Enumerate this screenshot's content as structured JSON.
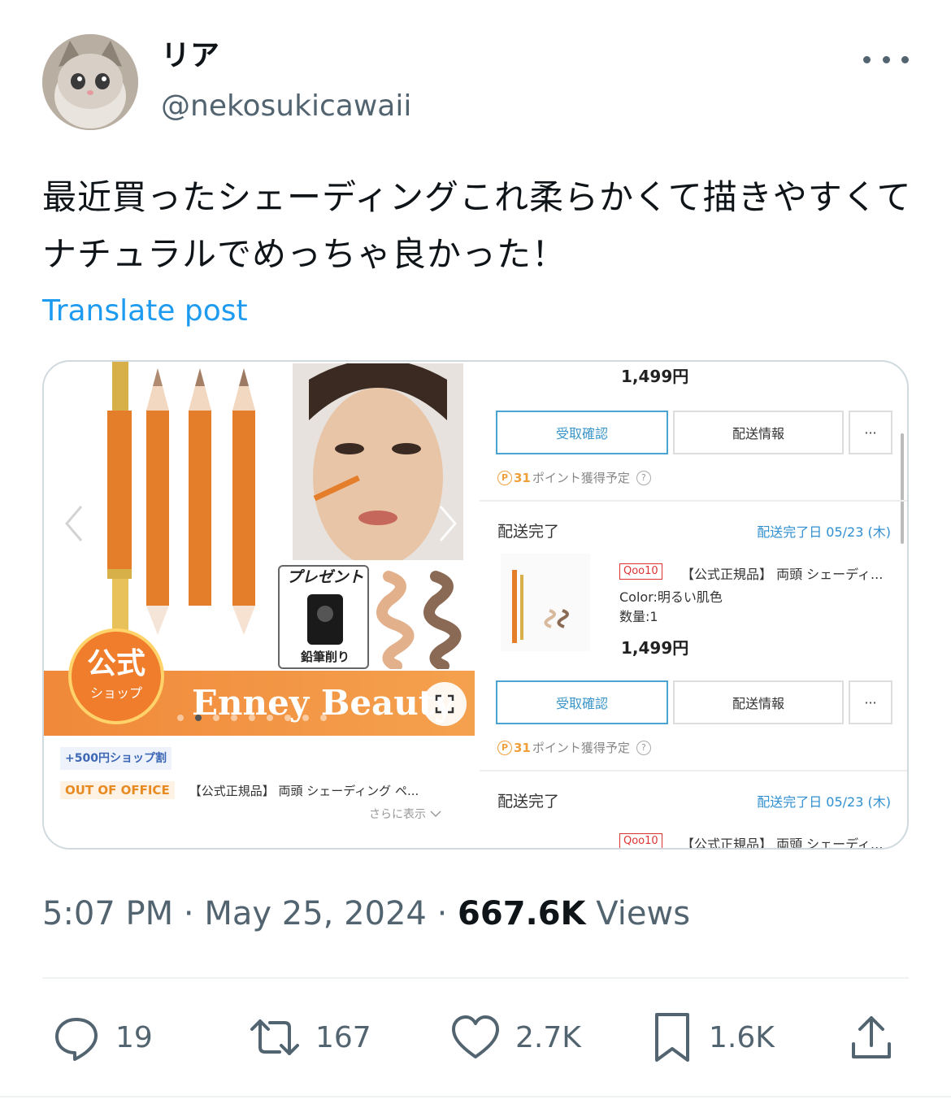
{
  "author": {
    "display_name": "リア",
    "handle": "@nekosukicawaii"
  },
  "tweet": {
    "text": "最近買ったシェーディングこれ柔らかくて描きやすくてナチュラルでめっちゃ良かった！",
    "translate_label": "Translate post"
  },
  "media": {
    "left": {
      "present_label": "プレゼント",
      "sharpener_label": "鉛筆削り",
      "badge_main": "公式",
      "badge_sub": "ショップ",
      "brand_banner": "Enney Beauty",
      "shop_discount": "+500円ショップ割",
      "shop_brand": "OUT OF OFFICE",
      "shop_title": "【公式正規品】 両頭 シェーディング ペ...",
      "see_more": "さらに表示"
    },
    "right": {
      "price_top": "1,499円",
      "confirm_label": "受取確認",
      "shipping_info_label": "配送情報",
      "more_label": "···",
      "points_number": "31",
      "points_text": "ポイント獲得予定",
      "status_label": "配送完了",
      "delivered_date": "配送完了日 05/23 (木)",
      "qoo_tag": "Qoo10",
      "item_title": "【公式正規品】 両頭 シェーディ...",
      "color_line": "Color:明るい肌色",
      "qty_line": "数量:1",
      "price": "1,499円"
    }
  },
  "meta": {
    "time": "5:07 PM",
    "date": "May 25, 2024",
    "views_count": "667.6K",
    "views_label": "Views"
  },
  "actions": {
    "replies": "19",
    "reposts": "167",
    "likes": "2.7K",
    "bookmarks": "1.6K"
  },
  "colors": {
    "link": "#1d9bf0",
    "secondary_text": "#536471",
    "banner_orange": "#f0893a"
  }
}
